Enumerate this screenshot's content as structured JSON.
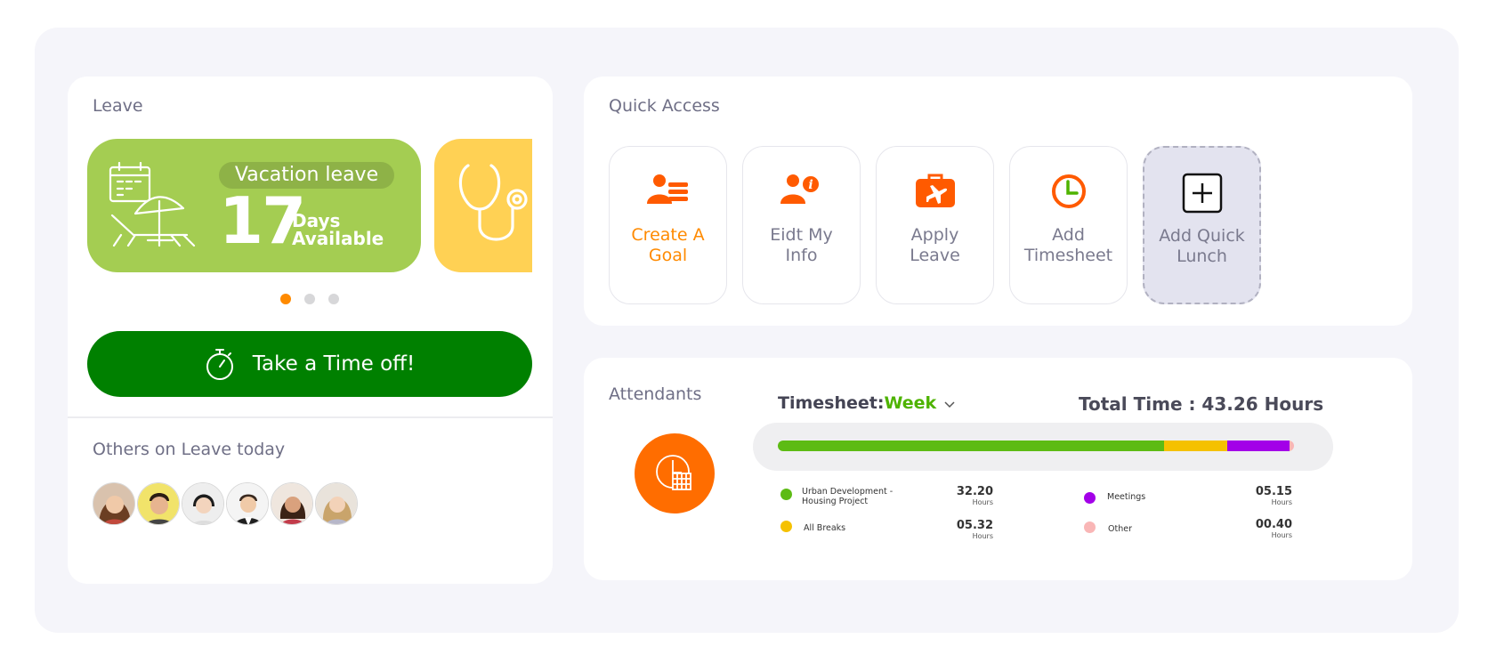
{
  "leave": {
    "title": "Leave",
    "vacation": {
      "label": "Vacation leave",
      "days": "17",
      "days_word": "Days",
      "available_word": "Available"
    },
    "carousel": {
      "count": 3,
      "active_index": 0
    },
    "time_off_button": "Take a Time off!",
    "others_title": "Others on Leave today",
    "others_count": 6
  },
  "quick_access": {
    "title": "Quick Access",
    "items": [
      {
        "label_line1": "Create A",
        "label_line2": "Goal",
        "icon": "goal-icon",
        "highlighted": true
      },
      {
        "label_line1": "Eidt My",
        "label_line2": "Info",
        "icon": "user-info-icon",
        "highlighted": false
      },
      {
        "label_line1": "Apply",
        "label_line2": "Leave",
        "icon": "suitcase-plane-icon",
        "highlighted": false
      },
      {
        "label_line1": "Add",
        "label_line2": "Timesheet",
        "icon": "clock-icon",
        "highlighted": false
      },
      {
        "label_line1": "Add Quick",
        "label_line2": "Lunch",
        "icon": "plus-square-icon",
        "highlighted": false
      }
    ]
  },
  "attendants": {
    "title": "Attendants",
    "timesheet_label": "Timesheet:",
    "timesheet_period": "Week",
    "total_time": "Total Time : 43.26 Hours",
    "segments": [
      {
        "name": "Urban Development - Housing Project",
        "value": "32.20",
        "hours": 32.2,
        "color": "#5dbb14"
      },
      {
        "name": "All Breaks",
        "value": "05.32",
        "hours": 5.32,
        "color": "#f5c100"
      },
      {
        "name": "Meetings",
        "value": "05.15",
        "hours": 5.15,
        "color": "#a300e8"
      },
      {
        "name": "Other",
        "value": "00.40",
        "hours": 0.4,
        "color": "#f9b6b6"
      }
    ],
    "unit": "Hours"
  },
  "colors": {
    "accent_orange": "#ff8a00",
    "button_green": "#008000",
    "vacation_green": "#a4cd52",
    "sick_yellow": "#ffd154"
  }
}
